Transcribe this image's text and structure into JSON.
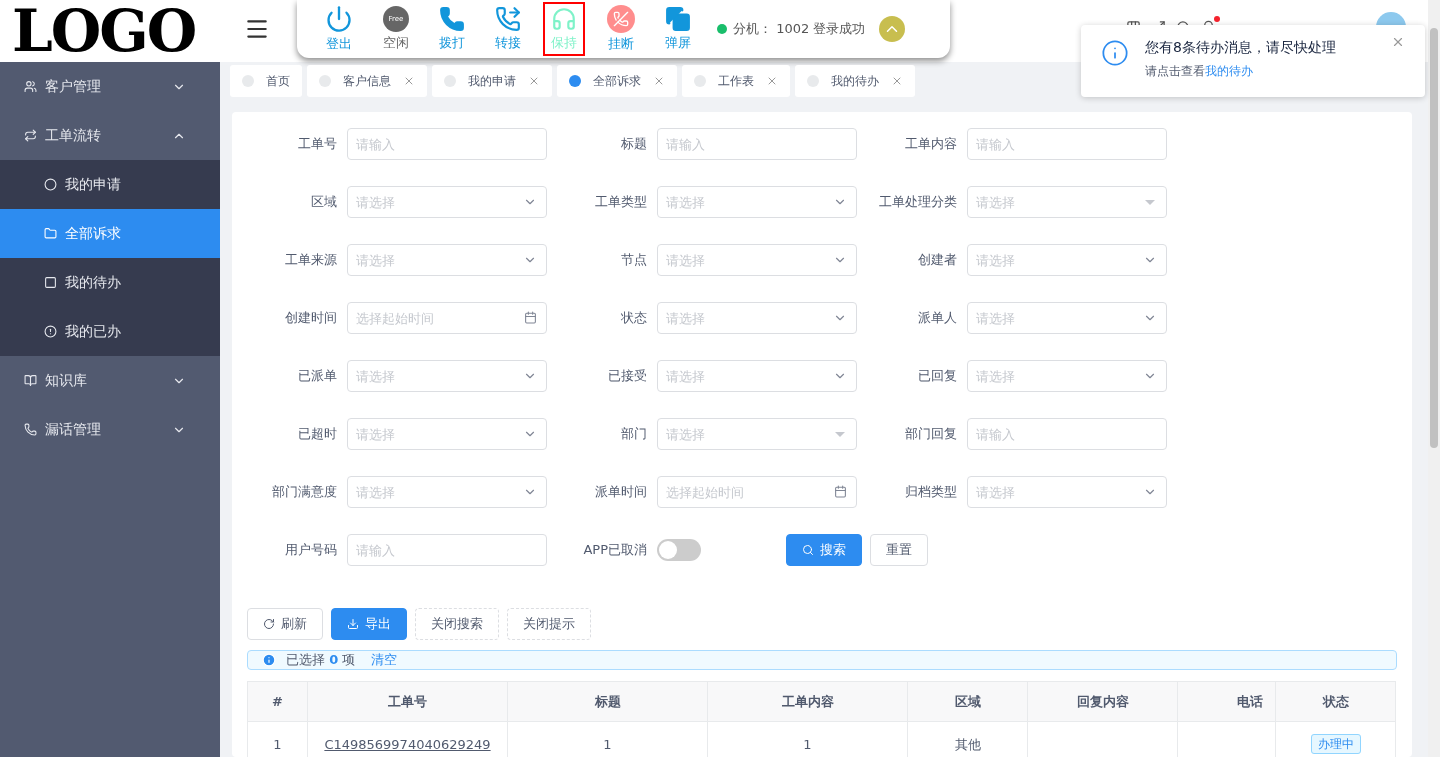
{
  "logo": "LOGO",
  "sidebar": {
    "items": [
      {
        "label": "客户管理",
        "expanded": false
      },
      {
        "label": "工单流转",
        "expanded": true,
        "children": [
          {
            "label": "我的申请",
            "selected": false
          },
          {
            "label": "全部诉求",
            "selected": true
          },
          {
            "label": "我的待办",
            "selected": false
          },
          {
            "label": "我的已办",
            "selected": false
          }
        ]
      },
      {
        "label": "知识库",
        "expanded": false
      },
      {
        "label": "漏话管理",
        "expanded": false
      }
    ]
  },
  "call_bar": {
    "buttons": [
      {
        "label": "登出",
        "selected": false
      },
      {
        "label": "空闲",
        "icon_text": "Free",
        "selected": false
      },
      {
        "label": "拨打",
        "selected": false
      },
      {
        "label": "转接",
        "selected": false
      },
      {
        "label": "保持",
        "selected": true
      },
      {
        "label": "挂断",
        "selected": false
      },
      {
        "label": "弹屏",
        "selected": false
      }
    ],
    "status": "分机： 1002 登录成功",
    "online": true
  },
  "tabs": [
    {
      "label": "首页",
      "selected": false,
      "closable": false
    },
    {
      "label": "客户信息",
      "selected": false,
      "closable": true
    },
    {
      "label": "我的申请",
      "selected": false,
      "closable": true
    },
    {
      "label": "全部诉求",
      "selected": true,
      "closable": true
    },
    {
      "label": "工作表",
      "selected": false,
      "closable": true
    },
    {
      "label": "我的待办",
      "selected": false,
      "closable": true
    }
  ],
  "notification": {
    "title": "您有8条待办消息，请尽快处理",
    "text": "请点击查看",
    "link": "我的待办"
  },
  "form": {
    "fields": [
      {
        "label": "工单号",
        "kind": "input",
        "placeholder": "请输入"
      },
      {
        "label": "标题",
        "kind": "input",
        "placeholder": "请输入"
      },
      {
        "label": "工单内容",
        "kind": "input",
        "placeholder": "请输入"
      },
      {
        "label": "区域",
        "kind": "select",
        "placeholder": "请选择"
      },
      {
        "label": "工单类型",
        "kind": "select",
        "placeholder": "请选择"
      },
      {
        "label": "工单处理分类",
        "kind": "cascader",
        "placeholder": "请选择"
      },
      {
        "label": "工单来源",
        "kind": "select",
        "placeholder": "请选择"
      },
      {
        "label": "节点",
        "kind": "select",
        "placeholder": "请选择"
      },
      {
        "label": "创建者",
        "kind": "select",
        "placeholder": "请选择"
      },
      {
        "label": "创建时间",
        "kind": "date",
        "placeholder": "选择起始时间"
      },
      {
        "label": "状态",
        "kind": "select",
        "placeholder": "请选择"
      },
      {
        "label": "派单人",
        "kind": "select",
        "placeholder": "请选择"
      },
      {
        "label": "已派单",
        "kind": "select",
        "placeholder": "请选择"
      },
      {
        "label": "已接受",
        "kind": "select",
        "placeholder": "请选择"
      },
      {
        "label": "已回复",
        "kind": "select",
        "placeholder": "请选择"
      },
      {
        "label": "已超时",
        "kind": "select",
        "placeholder": "请选择"
      },
      {
        "label": "部门",
        "kind": "cascader",
        "placeholder": "请选择"
      },
      {
        "label": "部门回复",
        "kind": "input",
        "placeholder": "请输入"
      },
      {
        "label": "部门满意度",
        "kind": "select",
        "placeholder": "请选择"
      },
      {
        "label": "派单时间",
        "kind": "date",
        "placeholder": "选择起始时间"
      },
      {
        "label": "归档类型",
        "kind": "select",
        "placeholder": "请选择"
      },
      {
        "label": "用户号码",
        "kind": "input",
        "placeholder": "请输入"
      },
      {
        "label": "APP已取消",
        "kind": "switch",
        "on": false
      }
    ],
    "search_button": "搜索",
    "reset_button": "重置"
  },
  "toolbar": [
    {
      "label": "刷新",
      "kind": "refresh"
    },
    {
      "label": "导出",
      "kind": "primary"
    },
    {
      "label": "关闭搜索",
      "kind": "dashed"
    },
    {
      "label": "关闭提示",
      "kind": "dashed"
    }
  ],
  "selection": {
    "prefix": "已选择",
    "count": "0",
    "suffix": "项",
    "clear": "清空"
  },
  "table": {
    "columns": [
      "#",
      "工单号",
      "标题",
      "工单内容",
      "区域",
      "回复内容",
      "电话",
      "状态"
    ],
    "rows": [
      {
        "cells": [
          "1",
          "C1498569974040629249",
          "1",
          "1",
          "其他",
          "",
          ""
        ],
        "status": "办理中"
      }
    ]
  }
}
